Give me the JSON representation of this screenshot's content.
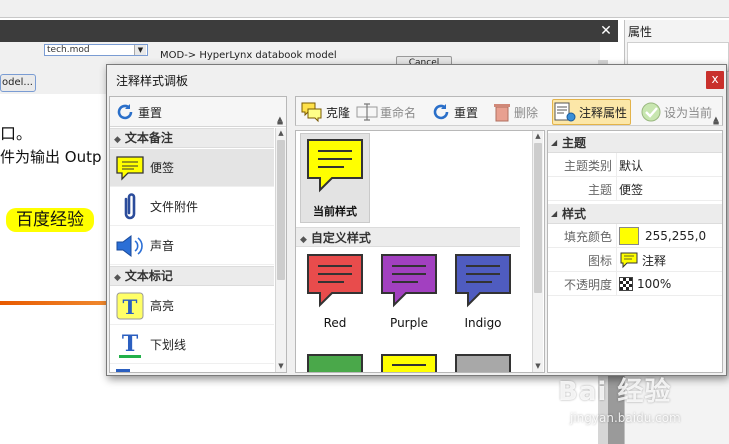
{
  "background_app": {
    "combo_value": "tech.mod",
    "mod_text": "MOD-> HyperLynx databook model",
    "cancel_label": "Cancel",
    "model_button_label": "odel...",
    "text_line1": "⼝。",
    "text_line2": "件为输出 Outp",
    "highlight_text": "百度经验",
    "properties_title": "属性"
  },
  "watermark": {
    "logo": "Bai 经验",
    "sub": "jingyan.baidu.com"
  },
  "dialog": {
    "title": "注释样式调板",
    "close_label": "x",
    "left": {
      "toolbar": {
        "reset_label": "重置"
      },
      "groups": [
        {
          "title": "文本备注",
          "items": [
            {
              "label": "便签",
              "icon": "sticky-note-icon"
            },
            {
              "label": "文件附件",
              "icon": "paperclip-icon"
            },
            {
              "label": "声音",
              "icon": "speaker-icon"
            }
          ]
        },
        {
          "title": "文本标记",
          "items": [
            {
              "label": "高亮",
              "icon": "highlight-text-icon"
            },
            {
              "label": "下划线",
              "icon": "underline-text-icon"
            }
          ]
        }
      ]
    },
    "toolbar": {
      "clone_label": "克隆",
      "rename_label": "重命名",
      "reset_label": "重置",
      "delete_label": "删除",
      "annotation_props_label": "注释属性",
      "set_current_label": "设为当前"
    },
    "middle": {
      "current_style_label": "当前样式",
      "custom_styles_header": "自定义样式",
      "current_color": "#ffff00",
      "custom_styles": [
        {
          "name": "Red",
          "color": "#e84c4c"
        },
        {
          "name": "Purple",
          "color": "#a240c0"
        },
        {
          "name": "Indigo",
          "color": "#4f5cc0"
        }
      ],
      "partial_row_colors": [
        "#4aa84a",
        "#ffff00",
        "#a8a8a8"
      ]
    },
    "properties": {
      "sections": [
        {
          "title": "主题",
          "rows": [
            {
              "key": "主题类别",
              "value": "默认"
            },
            {
              "key": "主题",
              "value": "便签"
            }
          ]
        },
        {
          "title": "样式",
          "rows": [
            {
              "key": "填充颜色",
              "value": "255,255,0",
              "swatch": "#ffff00"
            },
            {
              "key": "图标",
              "value": "注释"
            },
            {
              "key": "不透明度",
              "value": "100%"
            }
          ]
        }
      ]
    }
  }
}
